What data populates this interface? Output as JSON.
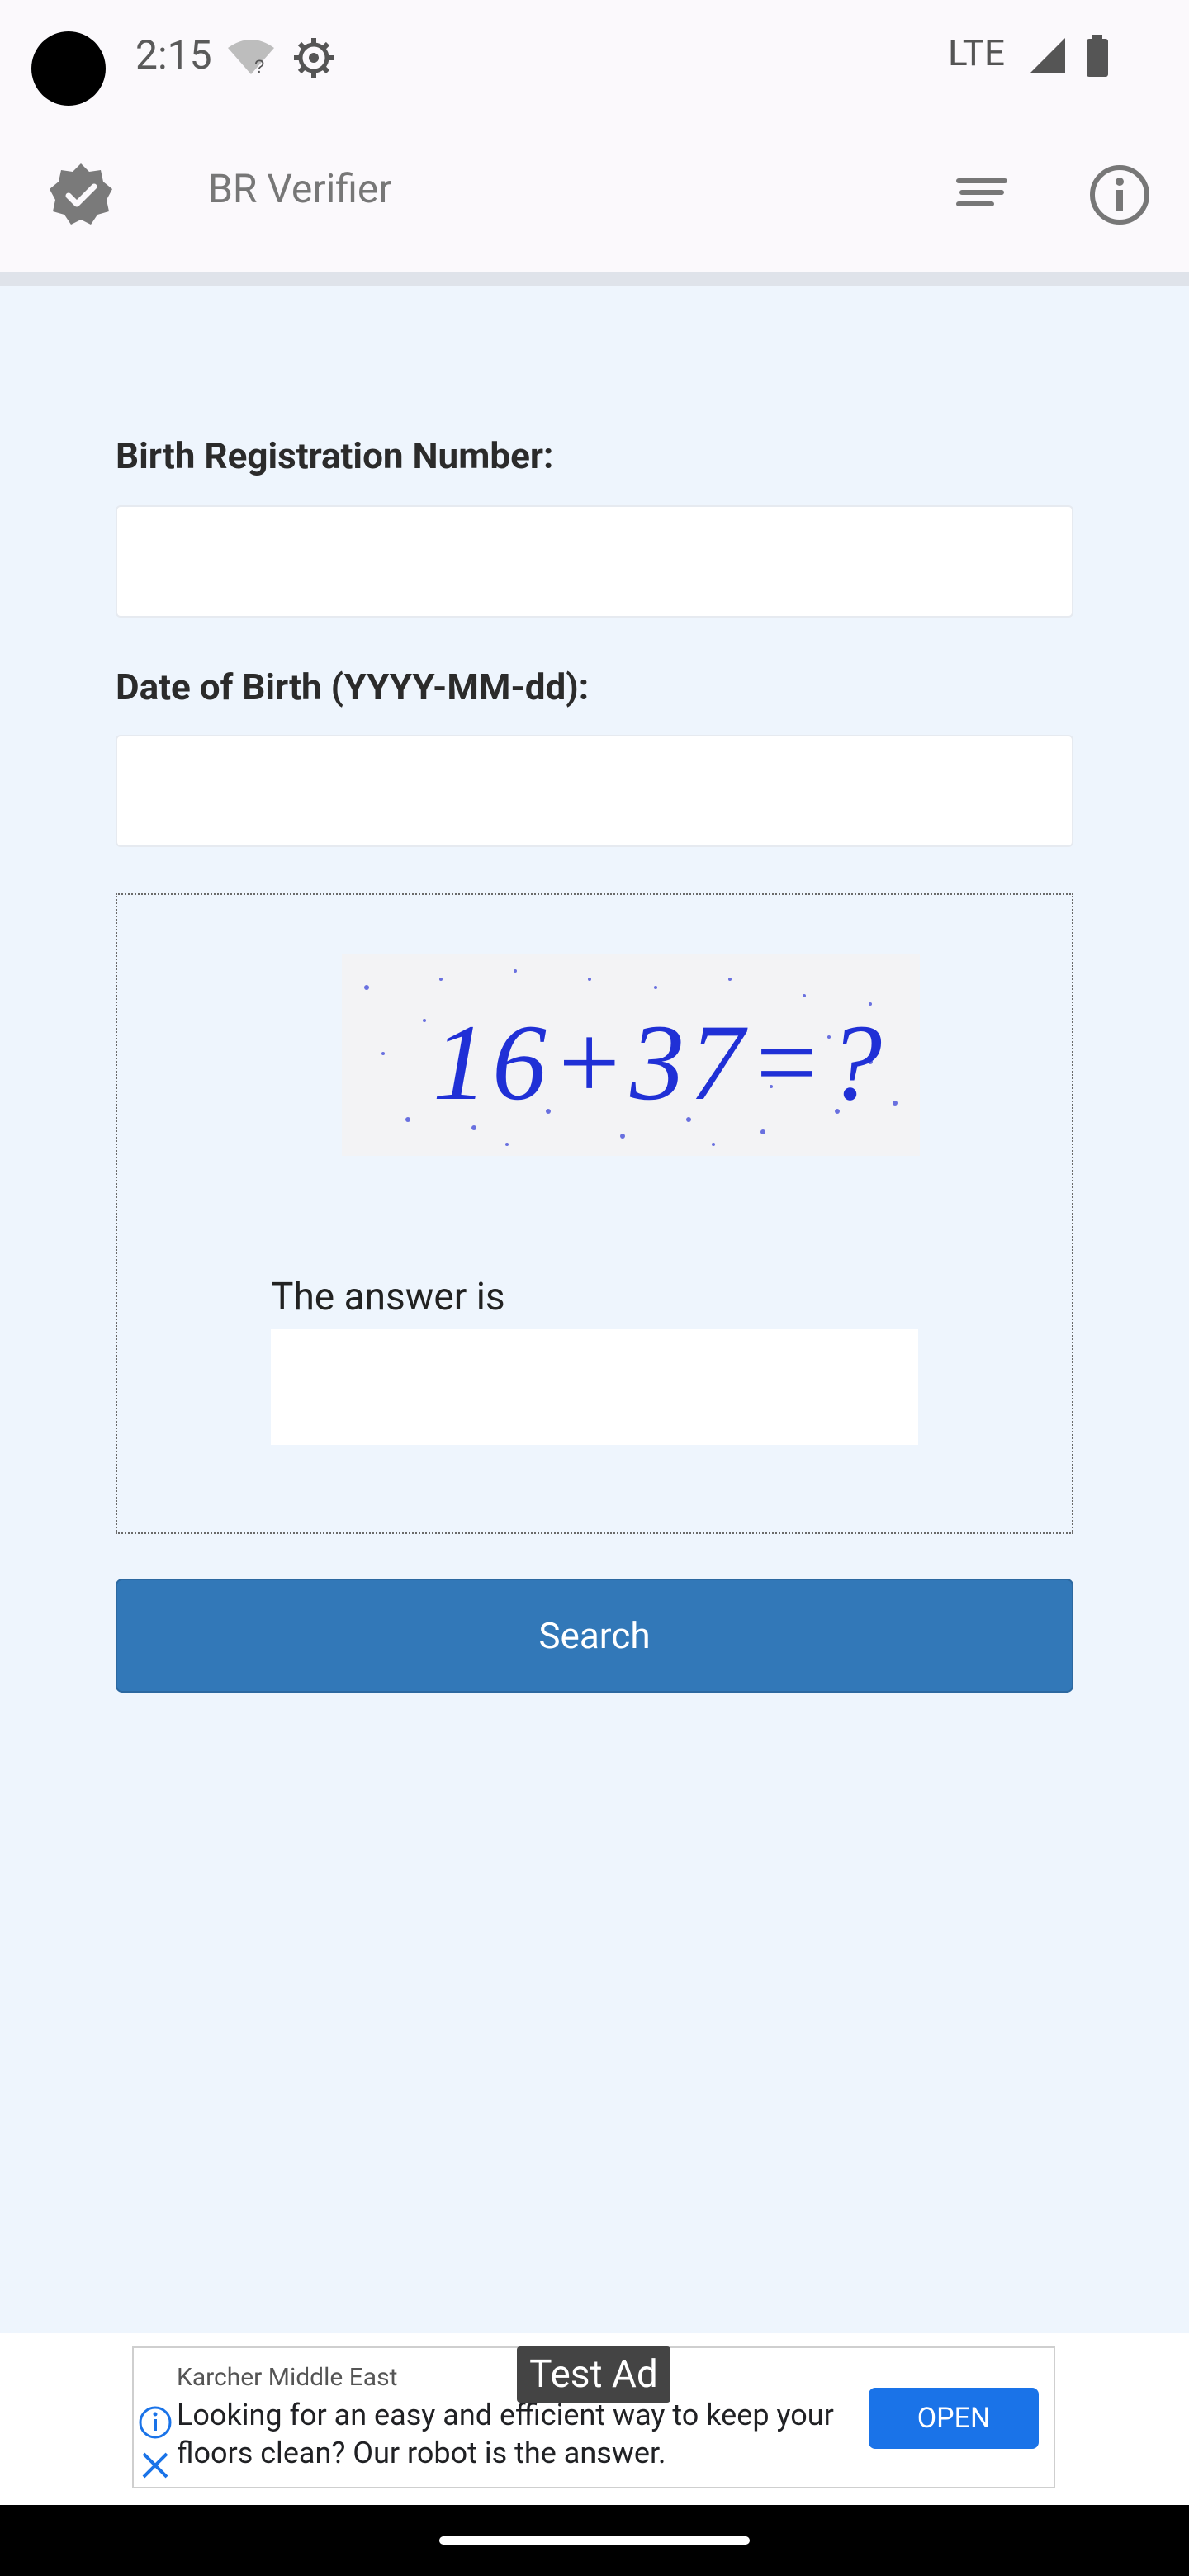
{
  "status_bar": {
    "time": "2:15",
    "network": "LTE",
    "icons": [
      "wifi-icon",
      "settings-icon",
      "signal-icon",
      "battery-icon"
    ]
  },
  "app_bar": {
    "title": "BR Verifier",
    "icons": [
      "verified-badge-icon",
      "menu-icon",
      "info-icon"
    ]
  },
  "form": {
    "brn_label": "Birth Registration Number:",
    "brn_value": "",
    "dob_label": "Date of Birth (YYYY-MM-dd):",
    "dob_value": "",
    "captcha_text": "16+37=?",
    "answer_label": "The answer is",
    "answer_value": "",
    "search_label": "Search"
  },
  "ad": {
    "badge": "Test Ad",
    "advertiser": "Karcher Middle East",
    "text": "Looking for an easy and efficient way to keep your floors clean? Our robot is the answer.",
    "open_label": "OPEN"
  },
  "colors": {
    "background": "#eef5fd",
    "primary_button": "#3278b8",
    "ad_button": "#1a73e8"
  }
}
